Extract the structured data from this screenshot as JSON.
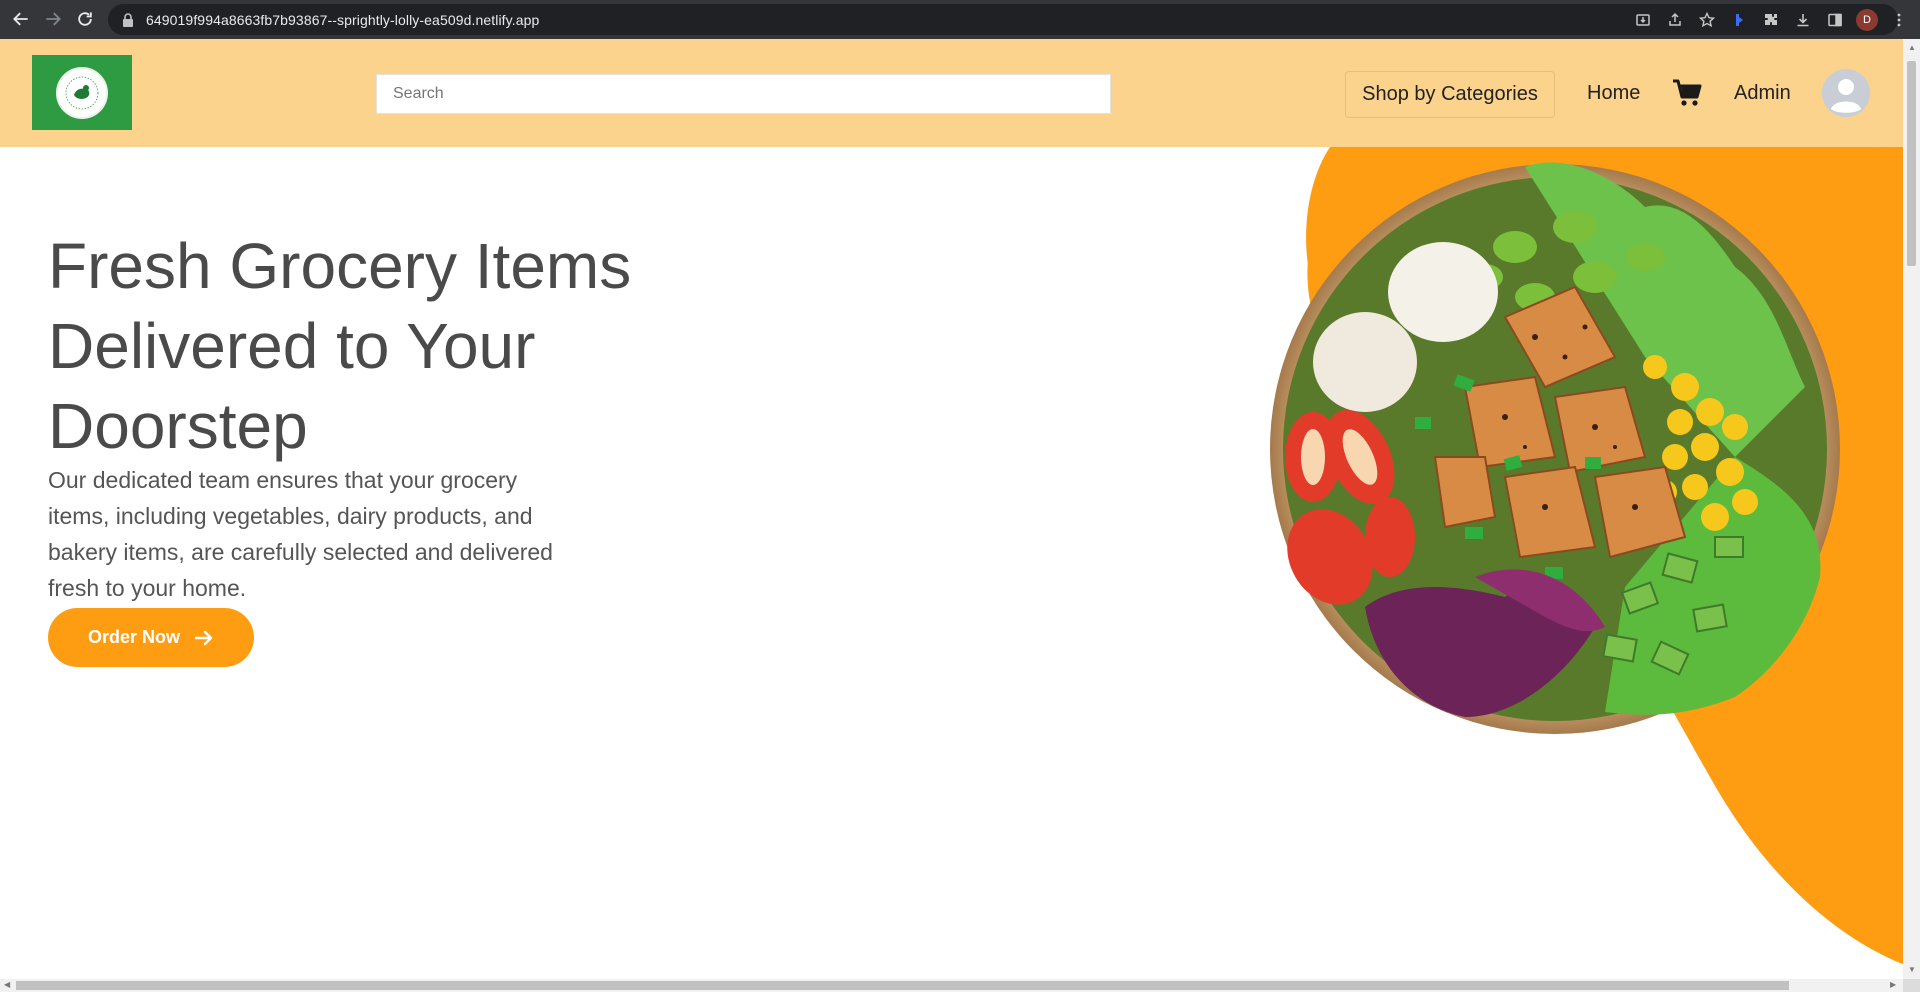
{
  "browser": {
    "url": "649019f994a8663fb7b93867--sprightly-lolly-ea509d.netlify.app",
    "profile_initial": "D"
  },
  "header": {
    "search_placeholder": "Search",
    "categories_label": "Shop by Categories",
    "home_label": "Home",
    "admin_label": "Admin"
  },
  "hero": {
    "title": "Fresh Grocery Items Delivered to Your Doorstep",
    "description": "Our dedicated team ensures that your grocery items, including vegetables, dairy products, and bakery items, are carefully selected and delivered fresh to your home.",
    "cta_label": "Order Now"
  },
  "colors": {
    "header_bg": "#fbd38d",
    "accent": "#fe9d11",
    "logo_bg": "#2e9b43"
  },
  "icons": [
    "back-icon",
    "forward-icon",
    "reload-icon",
    "lock-icon",
    "install-icon",
    "share-icon",
    "star-icon",
    "extension-icon",
    "puzzle-icon",
    "download-icon",
    "sidepanel-icon",
    "menu-icon",
    "cart-icon",
    "user-avatar-icon",
    "arrow-right-icon"
  ]
}
